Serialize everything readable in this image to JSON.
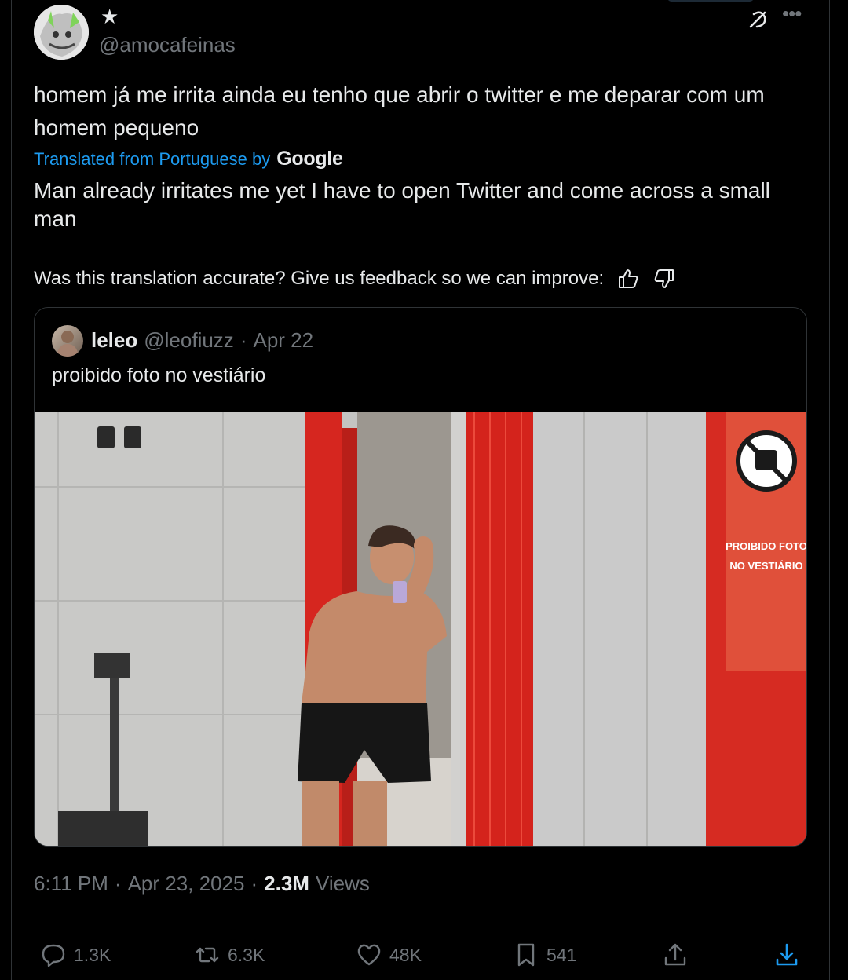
{
  "author": {
    "name_glyph": "★",
    "handle": "@amocafeinas"
  },
  "tweet": {
    "text": "homem já me irrita ainda eu tenho que abrir o twitter e me deparar com um homem pequeno",
    "translated_prefix": "Translated from Portuguese by",
    "translator": "Google",
    "translation": "Man already irritates me yet I have to open Twitter and come across a small man",
    "feedback_prompt": "Was this translation accurate? Give us feedback so we can improve:"
  },
  "quote": {
    "name": "leleo",
    "handle": "@leofiuzz",
    "separator": "·",
    "date": "Apr 22",
    "text": "proibido foto no vestiário",
    "sign_line1": "PROIBIDO FOTO",
    "sign_line2": "NO VESTIÁRIO"
  },
  "meta": {
    "time": "6:11 PM",
    "sep1": "·",
    "date": "Apr 23, 2025",
    "sep2": "·",
    "views_count": "2.3M",
    "views_label": "Views"
  },
  "actions": {
    "replies": "1.3K",
    "reposts": "6.3K",
    "likes": "48K",
    "bookmarks": "541"
  },
  "colors": {
    "background": "#000000",
    "text": "#e7e9ea",
    "secondary": "#71767b",
    "link": "#1d9bf0",
    "border": "#2f3336",
    "download_accent": "#1d9bf0"
  }
}
